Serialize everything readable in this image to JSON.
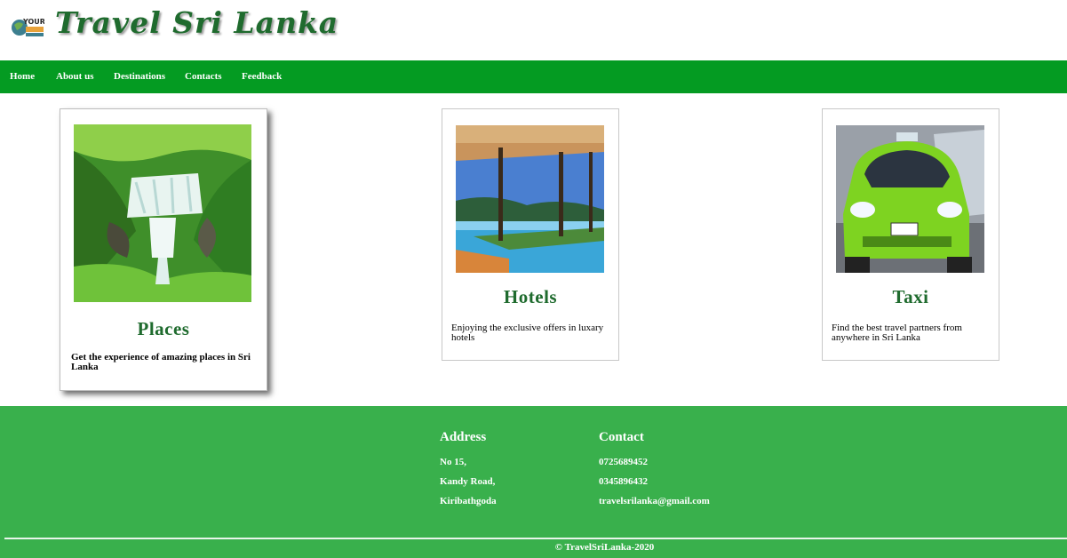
{
  "header": {
    "title": "Travel Sri Lanka",
    "logo_icon": "your-destination-logo-icon"
  },
  "nav": {
    "items": [
      {
        "label": "Home"
      },
      {
        "label": "About us"
      },
      {
        "label": "Destinations"
      },
      {
        "label": "Contacts"
      },
      {
        "label": "Feedback"
      }
    ]
  },
  "cards": [
    {
      "title": "Places",
      "description": "Get the experience of amazing places in Sri Lanka",
      "image_icon": "waterfall-image"
    },
    {
      "title": "Hotels",
      "description": "Enjoying the exclusive offers in luxary hotels",
      "image_icon": "hotel-pool-image"
    },
    {
      "title": "Taxi",
      "description": "Find the best travel partners from anywhere in Sri Lanka",
      "image_icon": "green-taxi-image"
    }
  ],
  "footer": {
    "address": {
      "heading": "Address",
      "lines": [
        "No 15,",
        "Kandy Road,",
        "Kiribathgoda"
      ]
    },
    "contact": {
      "heading": "Contact",
      "lines": [
        "0725689452",
        "0345896432",
        "travelsrilanka@gmail.com"
      ]
    },
    "copyright": "© TravelSriLanka-2020"
  },
  "colors": {
    "nav_green": "#049b22",
    "footer_green": "#39b04c",
    "title_green": "#1f6b2e"
  }
}
